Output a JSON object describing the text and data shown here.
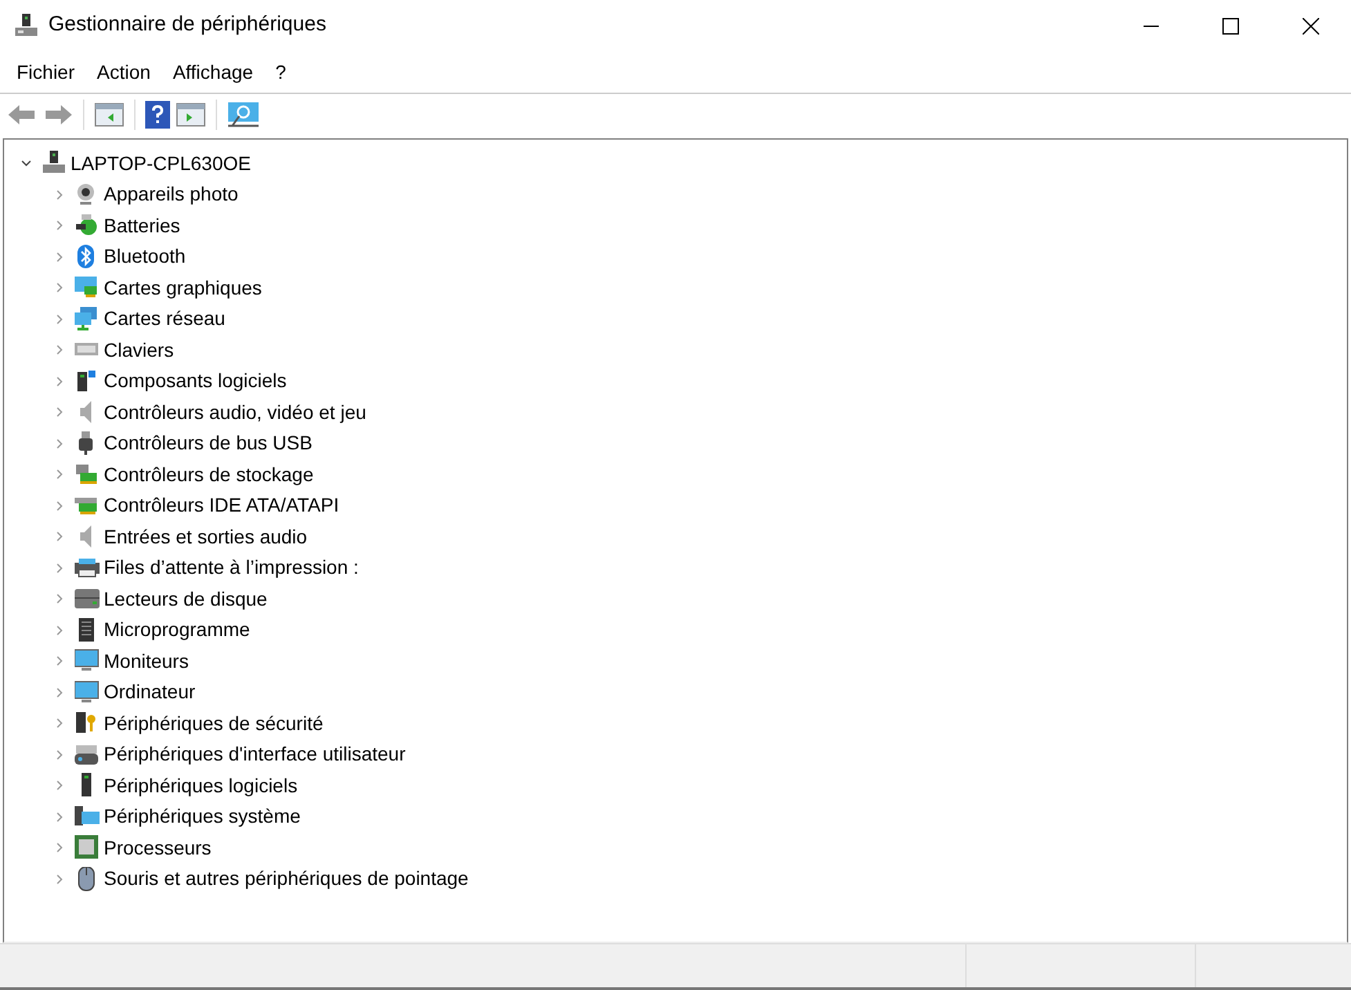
{
  "window": {
    "title": "Gestionnaire de périphériques"
  },
  "menu": [
    "Fichier",
    "Action",
    "Affichage",
    "?"
  ],
  "tree": {
    "label": "LAPTOP-CPL630OE",
    "expanded": true,
    "children": [
      {
        "label": "Appareils photo",
        "expanded": false
      },
      {
        "label": "Batteries",
        "expanded": false
      },
      {
        "label": "Bluetooth",
        "expanded": false
      },
      {
        "label": "Cartes graphiques",
        "expanded": false
      },
      {
        "label": "Cartes réseau",
        "expanded": false
      },
      {
        "label": "Claviers",
        "expanded": false
      },
      {
        "label": "Composants logiciels",
        "expanded": false
      },
      {
        "label": "Contrôleurs audio, vidéo et jeu",
        "expanded": false
      },
      {
        "label": "Contrôleurs de bus USB",
        "expanded": false
      },
      {
        "label": "Contrôleurs de stockage",
        "expanded": false
      },
      {
        "label": "Contrôleurs IDE ATA/ATAPI",
        "expanded": false
      },
      {
        "label": "Entrées et sorties audio",
        "expanded": false
      },
      {
        "label": "Files d’attente à l’impression :",
        "expanded": false
      },
      {
        "label": "Lecteurs de disque",
        "expanded": false
      },
      {
        "label": "Microprogramme",
        "expanded": false
      },
      {
        "label": "Moniteurs",
        "expanded": false
      },
      {
        "label": "Ordinateur",
        "expanded": false
      },
      {
        "label": "Périphériques de sécurité",
        "expanded": false
      },
      {
        "label": "Périphériques d'interface utilisateur",
        "expanded": false
      },
      {
        "label": "Périphériques logiciels",
        "expanded": false
      },
      {
        "label": "Périphériques système",
        "expanded": false
      },
      {
        "label": "Processeurs",
        "expanded": false
      },
      {
        "label": "Souris et autres périphériques de pointage",
        "expanded": false
      }
    ]
  }
}
